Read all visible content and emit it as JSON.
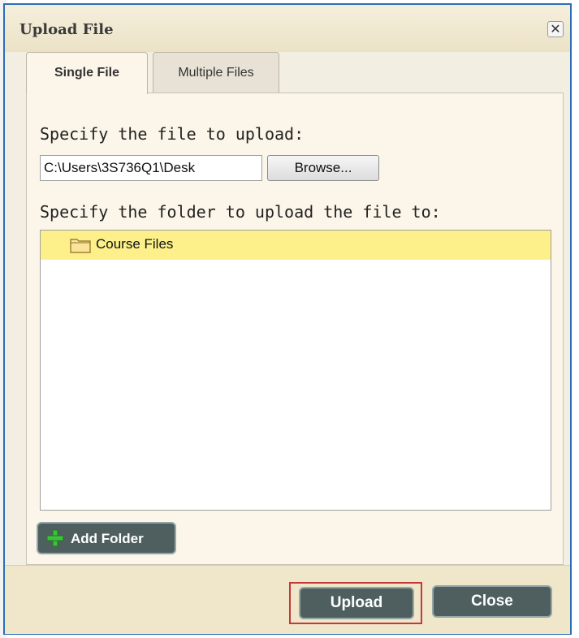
{
  "dialog": {
    "title": "Upload File",
    "close_glyph": "✕"
  },
  "tabs": [
    {
      "label": "Single File",
      "active": true
    },
    {
      "label": "Multiple Files",
      "active": false
    }
  ],
  "form": {
    "file_label": "Specify the file to upload:",
    "file_value": "C:\\Users\\3S736Q1\\Desk",
    "browse_label": "Browse...",
    "folder_label": "Specify the folder to upload the file to:"
  },
  "folder_tree": {
    "items": [
      {
        "label": "Course Files",
        "icon": "folder-icon",
        "selected": true
      }
    ]
  },
  "actions": {
    "add_folder_label": "Add Folder",
    "upload_label": "Upload",
    "close_label": "Close"
  },
  "colors": {
    "selected_row": "#fdf08a",
    "button_bg": "#4f5f5f",
    "highlight_border": "#c43a3a",
    "dialog_border": "#2a6fb3"
  }
}
